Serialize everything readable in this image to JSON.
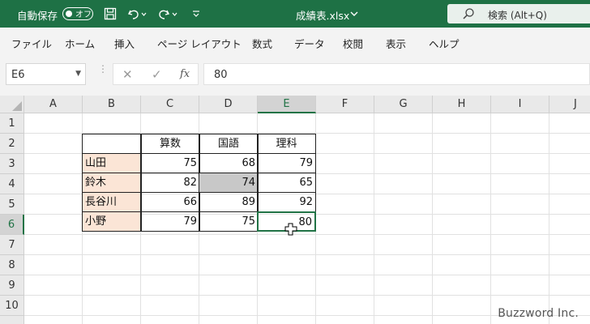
{
  "titlebar": {
    "autosave_label": "自動保存",
    "autosave_state": "オフ",
    "filename": "成績表.xlsx",
    "search_label": "検索 (Alt+Q)",
    "bg_color": "#1e7145"
  },
  "menu": [
    "ファイル",
    "ホーム",
    "挿入",
    "ページ レイアウト",
    "数式",
    "データ",
    "校閲",
    "表示",
    "ヘルプ"
  ],
  "formula_bar": {
    "name_box": "E6",
    "fx_label": "fx",
    "value": "80"
  },
  "grid": {
    "columns": [
      "A",
      "B",
      "C",
      "D",
      "E",
      "F",
      "G",
      "H",
      "I",
      "J"
    ],
    "rows": [
      "1",
      "2",
      "3",
      "4",
      "5",
      "6",
      "7",
      "8",
      "9",
      "10"
    ],
    "active_column": "E",
    "active_row": "6",
    "table": {
      "headers": [
        "",
        "算数",
        "国語",
        "理科"
      ],
      "rows": [
        {
          "name": "山田",
          "values": [
            "75",
            "68",
            "79"
          ]
        },
        {
          "name": "鈴木",
          "values": [
            "82",
            "74",
            "65"
          ]
        },
        {
          "name": "長谷川",
          "values": [
            "66",
            "89",
            "92"
          ]
        },
        {
          "name": "小野",
          "values": [
            "79",
            "75",
            "80"
          ]
        }
      ]
    },
    "name_fill_color": "#fbe5d6",
    "selected_fill_color": "#c8c8c8",
    "accent_color": "#217346"
  },
  "watermark": "Buzzword Inc."
}
